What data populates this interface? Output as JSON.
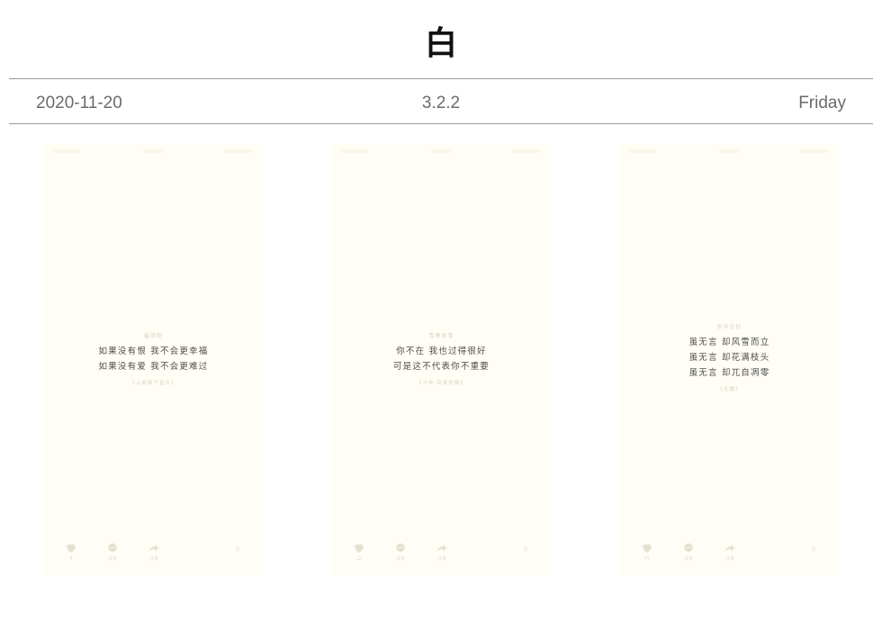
{
  "header": {
    "title": "白",
    "date": "2020-11-20",
    "version": "3.2.2",
    "weekday": "Friday"
  },
  "cards": [
    {
      "tag": "最简短",
      "lines": [
        "如果没有恨 我不会更幸福",
        "如果没有爱 我不会更难过"
      ],
      "source": "《上邪瓶子音乐》",
      "actions": {
        "like_count": "8",
        "comment_label": "评论",
        "share_label": "分享"
      }
    },
    {
      "tag": "青春故事",
      "lines": [
        "你不在 我也过得很好",
        "可是这不代表你不重要"
      ],
      "source": "《十年·后来的我》",
      "actions": {
        "like_count": "12",
        "comment_label": "评论",
        "share_label": "分享"
      }
    },
    {
      "tag": "岁岁在好",
      "lines": [
        "虽无言 却风雪而立",
        "虽无言 却花满枝头",
        "虽无言 却兀自凋零"
      ],
      "source": "《无题》",
      "actions": {
        "like_count": "27",
        "comment_label": "评论",
        "share_label": "分享"
      }
    }
  ],
  "icons": [
    "heart-icon",
    "comment-icon",
    "share-icon",
    "chevron-right-icon"
  ],
  "colors": {
    "card_bg": "#fffdf5",
    "rule": "#9a9a9a",
    "meta_text": "#6b6b6b",
    "quote_text": "#4d4d4d"
  }
}
